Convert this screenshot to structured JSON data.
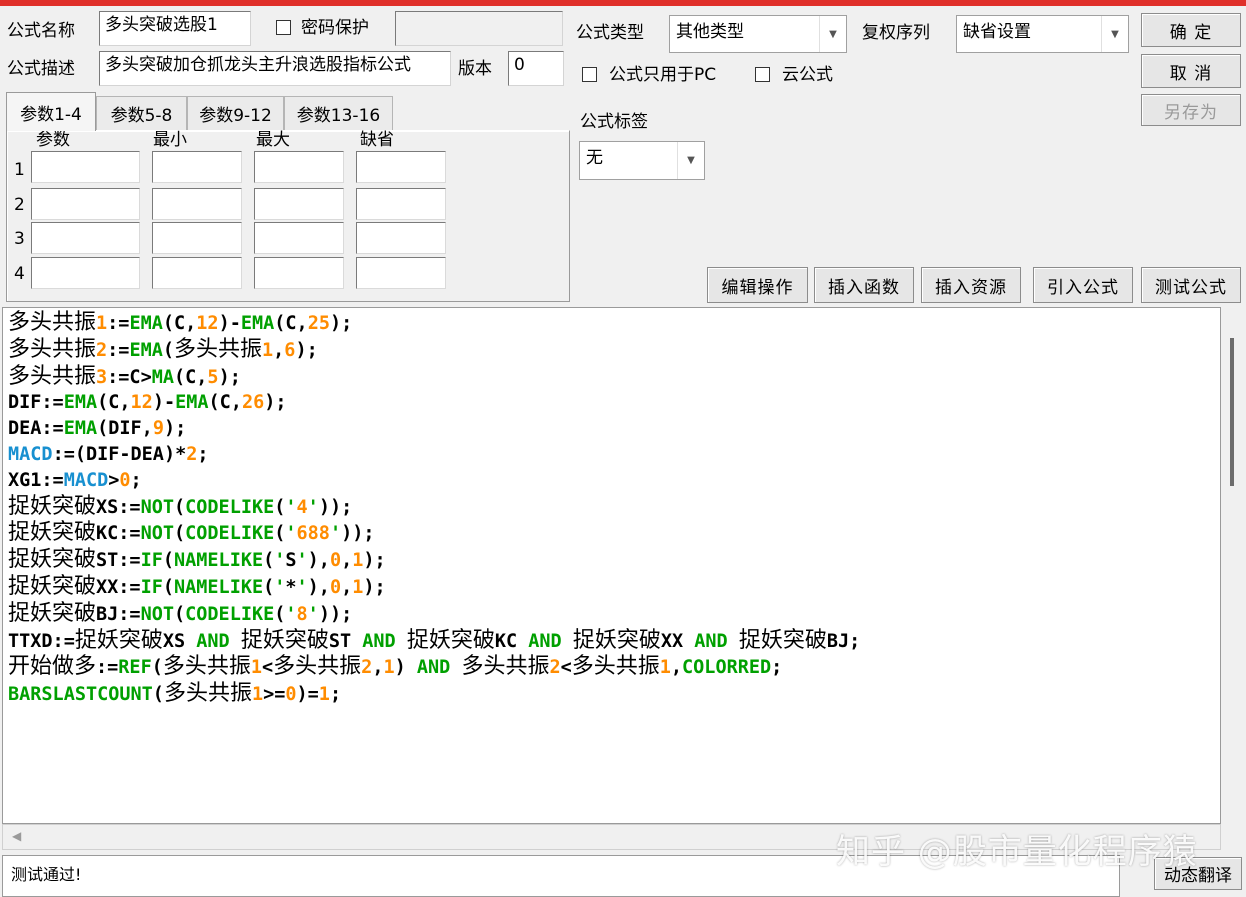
{
  "form": {
    "name_label": "公式名称",
    "name_value": "多头突破选股1",
    "password_label": "密码保护",
    "password_value": "",
    "desc_label": "公式描述",
    "desc_value": "多头突破加仓抓龙头主升浪选股指标公式",
    "version_label": "版本",
    "version_value": "0",
    "type_label": "公式类型",
    "type_value": "其他类型",
    "rights_label": "复权序列",
    "rights_value": "缺省设置",
    "pc_only_label": "公式只用于PC",
    "cloud_label": "云公式",
    "tag_label": "公式标签",
    "tag_value": "无"
  },
  "buttons": {
    "ok": "确 定",
    "cancel": "取 消",
    "save_as": "另存为",
    "edit_ops": "编辑操作",
    "insert_func": "插入函数",
    "insert_res": "插入资源",
    "import_formula": "引入公式",
    "test_formula": "测试公式",
    "dyn_translate": "动态翻译"
  },
  "tabs": [
    "参数1-4",
    "参数5-8",
    "参数9-12",
    "参数13-16"
  ],
  "param_table": {
    "headers": [
      "参数",
      "最小",
      "最大",
      "缺省"
    ],
    "rows": [
      "1",
      "2",
      "3",
      "4"
    ]
  },
  "code_lines": [
    "多头共振1:=EMA(C,12)-EMA(C,25);",
    "多头共振2:=EMA(多头共振1,6);",
    "多头共振3:=C>MA(C,5);",
    "DIF:=EMA(C,12)-EMA(C,26);",
    "DEA:=EMA(DIF,9);",
    "MACD:=(DIF-DEA)*2;",
    "XG1:=MACD>0;",
    "捉妖突破XS:=NOT(CODELIKE('4'));",
    "捉妖突破KC:=NOT(CODELIKE('688'));",
    "捉妖突破ST:=IF(NAMELIKE('S'),0,1);",
    "捉妖突破XX:=IF(NAMELIKE('*'),0,1);",
    "捉妖突破BJ:=NOT(CODELIKE('8'));",
    "TTXD:=捉妖突破XS AND 捉妖突破ST AND 捉妖突破KC AND 捉妖突破XX AND 捉妖突破BJ;",
    "开始做多:=REF(多头共振1<多头共振2,1) AND 多头共振2<多头共振1,COLORRED;",
    "BARSLASTCOUNT(多头共振1>=0)=1;"
  ],
  "status_text": "测试通过!",
  "watermark": "知乎 @股市量化程序猿",
  "colors": {
    "accent_bar": "#e0302a",
    "keyword": "#00a000",
    "number": "#ff8c00",
    "variable": "#1890d0"
  }
}
